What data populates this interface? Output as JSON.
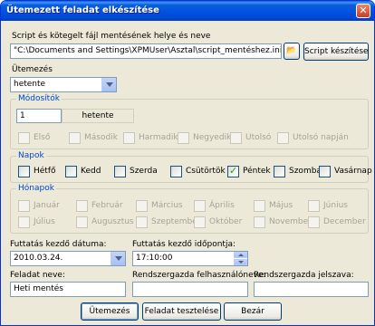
{
  "window": {
    "title": "Ütemezett feladat elkészítése",
    "close_label": "✕"
  },
  "script": {
    "label": "Script és kötegelt fájl mentésének helye és neve",
    "path": "\"C:\\Documents and Settings\\XPMUser\\Asztal\\script_mentéshez.ini\"",
    "create_button": "Script készítése"
  },
  "schedule": {
    "label": "Ütemezés",
    "value": "hetente"
  },
  "modifiers": {
    "legend": "Módosítók",
    "count": "1",
    "unit": "hetente",
    "items": [
      "Első",
      "Második",
      "Harmadik",
      "Negyedik",
      "Utolsó",
      "Utolsó napján"
    ]
  },
  "days": {
    "legend": "Napok",
    "items": [
      {
        "label": "Hétfő",
        "checked": false
      },
      {
        "label": "Kedd",
        "checked": false
      },
      {
        "label": "Szerda",
        "checked": false
      },
      {
        "label": "Csütörtök",
        "checked": false
      },
      {
        "label": "Péntek",
        "checked": true
      },
      {
        "label": "Szombat",
        "checked": false
      },
      {
        "label": "Vasárnap",
        "checked": false
      }
    ]
  },
  "months": {
    "legend": "Hónapok",
    "row1": [
      "Január",
      "Február",
      "Március",
      "Április",
      "Május",
      "Június"
    ],
    "row2": [
      "Július",
      "Augusztus",
      "Szeptember",
      "Október",
      "November",
      "December"
    ]
  },
  "start": {
    "date_label": "Futtatás kezdő dátuma:",
    "date_value": "2010.03.24.",
    "time_label": "Futtatás kezdő időpontja:",
    "time_value": "17:10:00"
  },
  "task": {
    "name_label": "Feladat neve:",
    "name_value": "Heti mentés",
    "admin_user_label": "Rendszergazda felhasználóneve:",
    "admin_user_value": "",
    "admin_pass_label": "Rendszergazda jelszava:",
    "admin_pass_value": ""
  },
  "buttons": {
    "schedule": "Ütemezés",
    "test": "Feladat tesztelése",
    "cancel": "Bezár"
  }
}
